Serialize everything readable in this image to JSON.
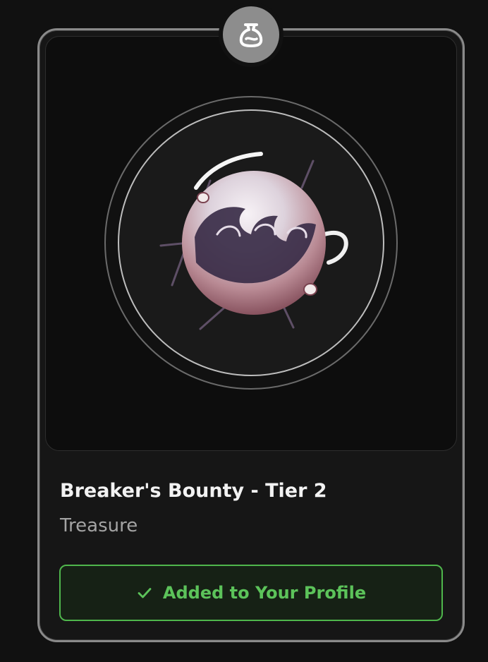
{
  "item": {
    "name": "Breaker's Bounty - Tier 2",
    "category": "Treasure",
    "category_icon": "pouch-icon",
    "artwork": "orb-icon"
  },
  "action": {
    "label": "Added to Your Profile",
    "state_icon": "check-icon",
    "accent_color": "#5cc35a"
  }
}
